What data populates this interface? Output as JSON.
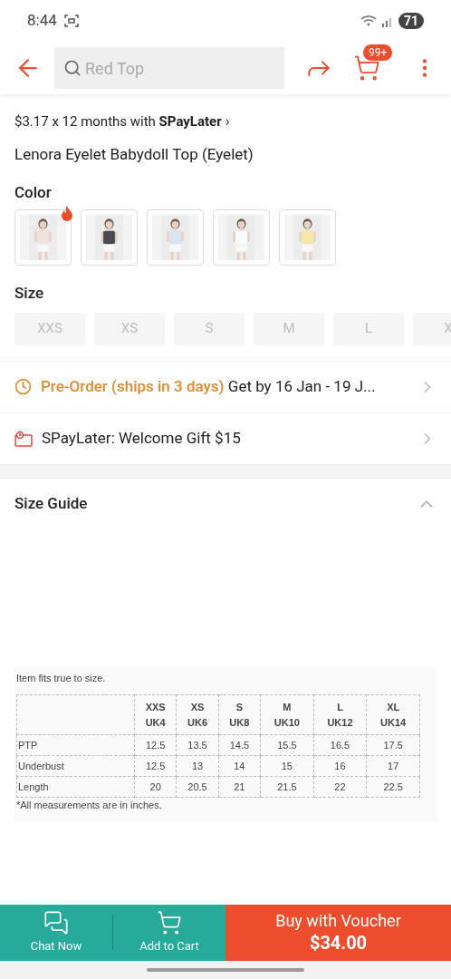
{
  "status_bar": {
    "time": "8:44",
    "battery": "71"
  },
  "header": {
    "search": {
      "placeholder": "Red Top"
    },
    "cart_badge": "99+"
  },
  "installment": {
    "text": "$3.17 x 12 months with **SPayLater**",
    "arrow": "›"
  },
  "product_title": "Lenora Eyelet Babydoll Top (Eyelet)",
  "color": {
    "label": "Color",
    "options": [
      {
        "kind": "picture",
        "hot": true
      },
      {
        "kind": "picture",
        "hot": false
      },
      {
        "kind": "picture",
        "hot": false
      },
      {
        "kind": "picture",
        "hot": false
      },
      {
        "kind": "picture",
        "hot": false
      }
    ]
  },
  "size": {
    "label": "Size",
    "options": [
      {
        "label": "XXS",
        "disabled": true
      },
      {
        "label": "XS",
        "disabled": true
      },
      {
        "label": "S",
        "disabled": true
      },
      {
        "label": "M",
        "disabled": true
      },
      {
        "label": "L",
        "disabled": true
      },
      {
        "label": "X",
        "disabled": true
      }
    ]
  },
  "rows": [
    {
      "kind": "shipping",
      "highlight": "Pre-Order (ships in 3 days)",
      "text": "Get by 16 Jan - 19 J..."
    },
    {
      "kind": "promo",
      "text": "SPayLater: Welcome Gift $15"
    }
  ],
  "size_guide": {
    "title": "Size Guide",
    "expanded": true,
    "chart": {
      "note": "Item fits true to size.",
      "columns": [
        [
          "XXS",
          "UK4"
        ],
        [
          "XS",
          "UK6"
        ],
        [
          "S",
          "UK8"
        ],
        [
          "M",
          "UK10"
        ],
        [
          "L",
          "UK12"
        ],
        [
          "XL",
          "UK14"
        ]
      ],
      "rows": [
        {
          "label": "PTP",
          "values": [
            "12.5",
            "13.5",
            "14.5",
            "15.5",
            "16.5",
            "17.5"
          ]
        },
        {
          "label": "Underbust",
          "values": [
            "12.5",
            "13",
            "14",
            "15",
            "16",
            "17"
          ]
        },
        {
          "label": "Length",
          "values": [
            "20",
            "20.5",
            "21",
            "21.5",
            "22",
            "22.5"
          ]
        }
      ],
      "footnote": "*All measurements are in inches."
    }
  },
  "bottom_bar": {
    "chat": "Chat Now",
    "cart": "Add to Cart",
    "buy_label": "Buy with Voucher",
    "buy_price": "$34.00"
  }
}
